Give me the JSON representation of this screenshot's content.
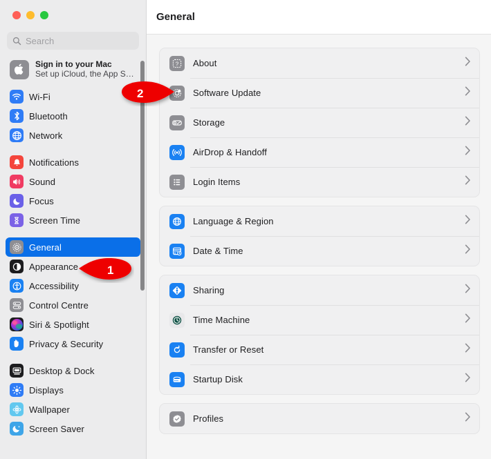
{
  "window": {
    "traffic_lights": [
      "close",
      "minimize",
      "maximize"
    ],
    "colors": {
      "close": "#ff5f57",
      "minimize": "#febc2e",
      "maximize": "#28c840",
      "accent_selected": "#0a6fe8",
      "marker_red": "#ee0000",
      "sidebar_bg": "#ececed",
      "main_bg": "#f5f5f5",
      "card_bg": "#f0f0f1"
    }
  },
  "search": {
    "placeholder": "Search",
    "value": "",
    "icon": "search-icon"
  },
  "account": {
    "icon": "apple-logo-icon",
    "title": "Sign in to your Mac",
    "subtitle": "Set up iCloud, the App S…"
  },
  "sidebar": {
    "groups": [
      {
        "items": [
          {
            "label": "Wi-Fi",
            "icon": "wifi-icon",
            "selected": false
          },
          {
            "label": "Bluetooth",
            "icon": "bluetooth-icon",
            "selected": false
          },
          {
            "label": "Network",
            "icon": "globe-network-icon",
            "selected": false
          }
        ]
      },
      {
        "items": [
          {
            "label": "Notifications",
            "icon": "bell-icon",
            "selected": false
          },
          {
            "label": "Sound",
            "icon": "speaker-icon",
            "selected": false
          },
          {
            "label": "Focus",
            "icon": "moon-icon",
            "selected": false
          },
          {
            "label": "Screen Time",
            "icon": "hourglass-icon",
            "selected": false
          }
        ]
      },
      {
        "items": [
          {
            "label": "General",
            "icon": "gear-icon",
            "selected": true
          },
          {
            "label": "Appearance",
            "icon": "appearance-contrast-icon",
            "selected": false
          },
          {
            "label": "Accessibility",
            "icon": "accessibility-person-icon",
            "selected": false
          },
          {
            "label": "Control Centre",
            "icon": "control-centre-icon",
            "selected": false
          },
          {
            "label": "Siri & Spotlight",
            "icon": "siri-orb-icon",
            "selected": false
          },
          {
            "label": "Privacy & Security",
            "icon": "hand-privacy-icon",
            "selected": false
          }
        ]
      },
      {
        "items": [
          {
            "label": "Desktop & Dock",
            "icon": "desktop-dock-icon",
            "selected": false
          },
          {
            "label": "Displays",
            "icon": "brightness-icon",
            "selected": false
          },
          {
            "label": "Wallpaper",
            "icon": "wallpaper-flower-icon",
            "selected": false
          },
          {
            "label": "Screen Saver",
            "icon": "screen-saver-moon-icon",
            "selected": false
          }
        ]
      }
    ],
    "scrollbar": "sidebar-scrollbar"
  },
  "main": {
    "title": "General",
    "cards": [
      {
        "rows": [
          {
            "label": "About",
            "icon": "about-question-icon",
            "chevron": "›"
          },
          {
            "label": "Software Update",
            "icon": "software-update-gear-icon",
            "chevron": "›"
          },
          {
            "label": "Storage",
            "icon": "storage-disk-icon",
            "chevron": "›"
          },
          {
            "label": "AirDrop & Handoff",
            "icon": "airdrop-icon",
            "chevron": "›"
          },
          {
            "label": "Login Items",
            "icon": "login-items-list-icon",
            "chevron": "›"
          }
        ]
      },
      {
        "rows": [
          {
            "label": "Language & Region",
            "icon": "language-globe-icon",
            "chevron": "›"
          },
          {
            "label": "Date & Time",
            "icon": "date-time-calendar-icon",
            "chevron": "›"
          }
        ]
      },
      {
        "rows": [
          {
            "label": "Sharing",
            "icon": "sharing-icon",
            "chevron": "›"
          },
          {
            "label": "Time Machine",
            "icon": "time-machine-clock-icon",
            "chevron": "›"
          },
          {
            "label": "Transfer or Reset",
            "icon": "transfer-reset-icon",
            "chevron": "›"
          },
          {
            "label": "Startup Disk",
            "icon": "startup-disk-icon",
            "chevron": "›"
          }
        ]
      },
      {
        "rows": [
          {
            "label": "Profiles",
            "icon": "profiles-badge-icon",
            "chevron": "›"
          }
        ]
      }
    ]
  },
  "annotations": [
    {
      "number": "1",
      "direction": "left",
      "target": "General sidebar item"
    },
    {
      "number": "2",
      "direction": "right",
      "target": "Software Update row"
    }
  ]
}
